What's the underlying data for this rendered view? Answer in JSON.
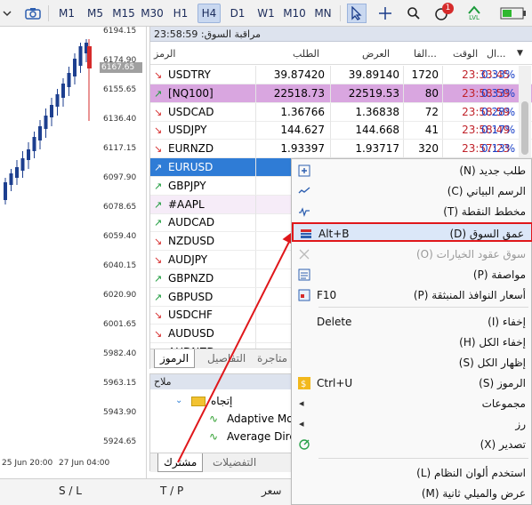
{
  "toolbar": {
    "timeframes": [
      "M1",
      "M5",
      "M15",
      "M30",
      "H1",
      "H4",
      "D1",
      "W1",
      "M10",
      "MN"
    ],
    "active_timeframe": "H4",
    "notification_count": "1",
    "lvl_badge": "LVL"
  },
  "chart": {
    "prices": [
      "6194.15",
      "6174.90",
      "6155.65",
      "6136.40",
      "6117.15",
      "6097.90",
      "6078.65",
      "6059.40",
      "6040.15",
      "6020.90",
      "6001.65",
      "5982.40",
      "5963.15",
      "5943.90",
      "5924.65"
    ],
    "current_price": "6167.65",
    "dates": [
      "25 Jun 20:00",
      "27 Jun 04:00"
    ]
  },
  "market_watch": {
    "title": "مراقبة السوق: 23:58:59",
    "columns": {
      "symbol": "الرمز",
      "bid": "الطلب",
      "ask": "العرض",
      "spread": "الفا...",
      "time": "الوقت",
      "change": "ال..."
    },
    "rows": [
      {
        "symbol": "USDTRY",
        "dir": "down",
        "bid": "39.87420",
        "ask": "39.89140",
        "spread": "1720",
        "time": "23:33:45",
        "change": "0.33%"
      },
      {
        "symbol": "[NQ100]",
        "dir": "up",
        "bid": "22518.73",
        "ask": "22519.53",
        "spread": "80",
        "time": "23:58:59",
        "change": "0.33%"
      },
      {
        "symbol": "USDCAD",
        "dir": "down",
        "bid": "1.36766",
        "ask": "1.36838",
        "spread": "72",
        "time": "23:58:59",
        "change": "0.28%"
      },
      {
        "symbol": "USDJPY",
        "dir": "down",
        "bid": "144.627",
        "ask": "144.668",
        "spread": "41",
        "time": "23:58:49",
        "change": "0.17%"
      },
      {
        "symbol": "EURNZD",
        "dir": "down",
        "bid": "1.93397",
        "ask": "1.93717",
        "spread": "320",
        "time": "23:57:23",
        "change": "0.13%"
      },
      {
        "symbol": "EURUSD",
        "dir": "up",
        "bid": "1.17",
        "ask": "",
        "spread": "",
        "time": "",
        "change": ""
      },
      {
        "symbol": "GBPJPY",
        "dir": "up",
        "bid": "198.",
        "ask": "",
        "spread": "",
        "time": "",
        "change": ""
      },
      {
        "symbol": "#AAPL",
        "dir": "up",
        "bid": "201",
        "ask": "",
        "spread": "",
        "time": "",
        "change": ""
      },
      {
        "symbol": "AUDCAD",
        "dir": "up",
        "bid": "0.89",
        "ask": "",
        "spread": "",
        "time": "",
        "change": ""
      },
      {
        "symbol": "NZDUSD",
        "dir": "down",
        "bid": "0.60",
        "ask": "",
        "spread": "",
        "time": "",
        "change": ""
      },
      {
        "symbol": "AUDJPY",
        "dir": "down",
        "bid": "94.",
        "ask": "",
        "spread": "",
        "time": "",
        "change": ""
      },
      {
        "symbol": "GBPNZD",
        "dir": "up",
        "bid": "2.26",
        "ask": "",
        "spread": "",
        "time": "",
        "change": ""
      },
      {
        "symbol": "GBPUSD",
        "dir": "up",
        "bid": "1.37",
        "ask": "",
        "spread": "",
        "time": "",
        "change": ""
      },
      {
        "symbol": "USDCHF",
        "dir": "down",
        "bid": "0.79",
        "ask": "",
        "spread": "",
        "time": "",
        "change": ""
      },
      {
        "symbol": "AUDUSD",
        "dir": "down",
        "bid": "0.65",
        "ask": "",
        "spread": "",
        "time": "",
        "change": ""
      },
      {
        "symbol": "AUDNZD",
        "dir": "down",
        "bid": "1.07",
        "ask": "",
        "spread": "",
        "time": "",
        "change": ""
      }
    ],
    "tabs": {
      "symbols": "الرموز",
      "details": "التفاصيل",
      "trading": "متاجرة"
    }
  },
  "navigator": {
    "title": "ملاح",
    "folder": "إتجاه",
    "items": [
      "Adaptive Mo",
      "Average Dire",
      "Average Dir"
    ],
    "tabs": {
      "subscribed": "مشترك",
      "favorites": "التفضيلات"
    }
  },
  "bottom": {
    "sl": "S / L",
    "tp": "T / P",
    "price": "سعر"
  },
  "context_menu": {
    "items": [
      {
        "label": "طلب جديد (N)",
        "shortcut": "",
        "icon": "new-order-icon",
        "state": "normal"
      },
      {
        "label": "الرسم البياني (C)",
        "shortcut": "",
        "icon": "chart-icon",
        "state": "normal"
      },
      {
        "label": "مخطط النقطة (T)",
        "shortcut": "",
        "icon": "tick-chart-icon",
        "state": "normal"
      },
      {
        "label": "عمق السوق (D)",
        "shortcut": "Alt+B",
        "icon": "depth-of-market-icon",
        "state": "highlight"
      },
      {
        "label": "سوق عقود الخيارات (O)",
        "shortcut": "",
        "icon": "options-icon",
        "state": "disabled"
      },
      {
        "label": "مواصفة (P)",
        "shortcut": "",
        "icon": "specification-icon",
        "state": "normal"
      },
      {
        "label": "أسعار النوافذ المنبثقة (P)",
        "shortcut": "F10",
        "icon": "popup-prices-icon",
        "state": "normal"
      },
      {
        "label": "إخفاء (I)",
        "shortcut": "Delete",
        "icon": "",
        "state": "normal"
      },
      {
        "label": "إخفاء الكل (H)",
        "shortcut": "",
        "icon": "",
        "state": "normal"
      },
      {
        "label": "إظهار الكل (S)",
        "shortcut": "",
        "icon": "",
        "state": "normal"
      },
      {
        "label": "الرموز (S)",
        "shortcut": "Ctrl+U",
        "icon": "symbols-icon",
        "state": "normal"
      },
      {
        "label": "مجموعات",
        "shortcut": "",
        "icon": "",
        "state": "submenu"
      },
      {
        "label": "رز",
        "shortcut": "",
        "icon": "",
        "state": "submenu"
      },
      {
        "label": "تصدير (X)",
        "shortcut": "",
        "icon": "export-icon",
        "state": "normal"
      },
      {
        "label": "استخدم ألوان النظام (L)",
        "shortcut": "",
        "icon": "",
        "state": "normal"
      },
      {
        "label": "عرض والميلي ثانية (M)",
        "shortcut": "",
        "icon": "",
        "state": "normal"
      }
    ]
  }
}
